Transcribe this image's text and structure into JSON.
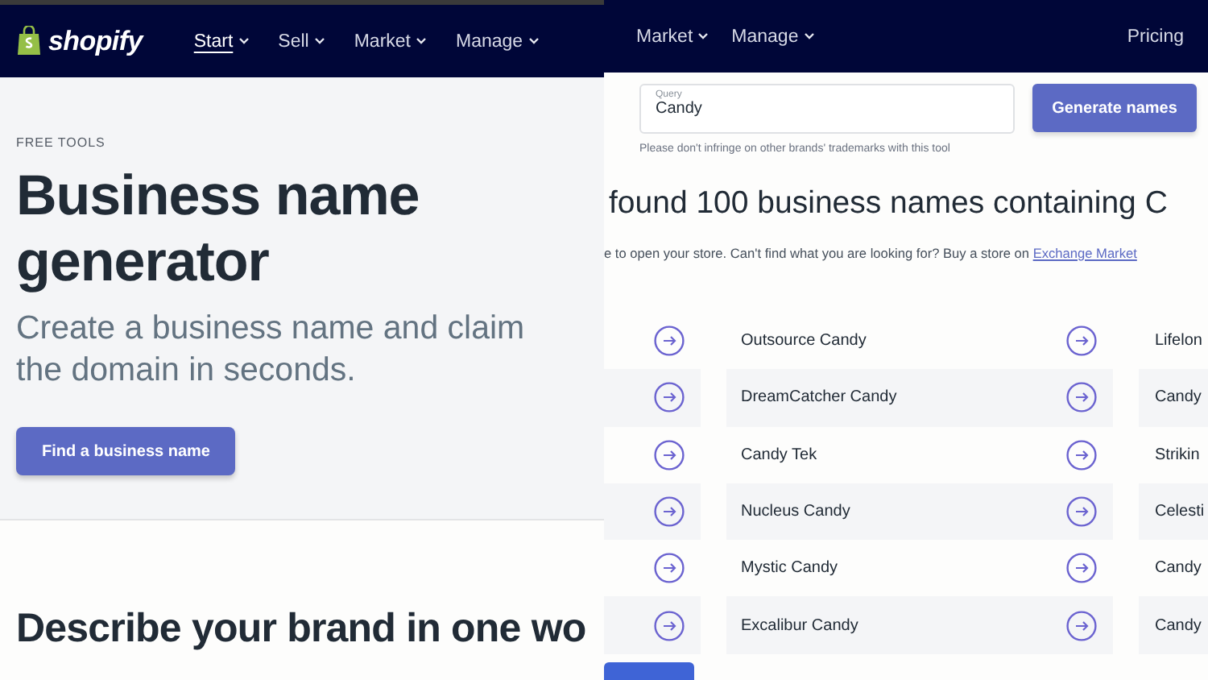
{
  "left": {
    "nav": {
      "logo": "shopify",
      "items": [
        {
          "label": "Start",
          "selected": true
        },
        {
          "label": "Sell",
          "selected": false
        },
        {
          "label": "Market",
          "selected": false
        },
        {
          "label": "Manage",
          "selected": false
        }
      ]
    },
    "eyebrow": "FREE TOOLS",
    "title": "Business name generator",
    "subtitle": "Create a business name and claim the domain in seconds.",
    "cta": "Find a business name",
    "section_heading": "Describe your brand in one wo"
  },
  "right": {
    "nav": {
      "items": [
        {
          "label": "Market"
        },
        {
          "label": "Manage"
        }
      ],
      "pricing": "Pricing"
    },
    "query": {
      "label": "Query",
      "value": "Candy"
    },
    "generate_button": "Generate names",
    "hint": "Please don't infringe on other brands' trademarks with this tool",
    "results_heading": "found 100 business names containing C",
    "results_text": "e to open your store. Can't find what you are looking for? Buy a store on ",
    "results_link": "Exchange Market",
    "rows": [
      {
        "column_2": "Outsource Candy",
        "column_3": "Lifelon"
      },
      {
        "column_2": "DreamCatcher Candy",
        "column_3": "Candy"
      },
      {
        "column_2": "Candy Tek",
        "column_3": "Strikin"
      },
      {
        "column_2": "Nucleus Candy",
        "column_3": "Celesti"
      },
      {
        "column_2": "Mystic Candy",
        "column_3": "Candy"
      },
      {
        "column_2": "Excalibur Candy",
        "column_3": "Candy"
      }
    ]
  }
}
